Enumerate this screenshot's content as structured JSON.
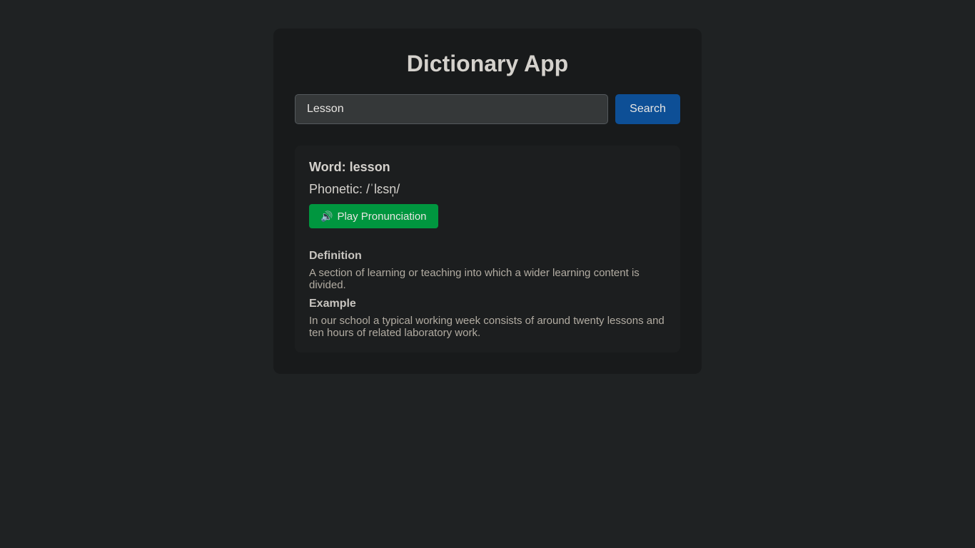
{
  "app": {
    "title": "Dictionary App"
  },
  "search": {
    "value": "Lesson",
    "button_label": "Search"
  },
  "result": {
    "word_label": "Word: lesson",
    "phonetic_label": "Phonetic: /ˈlɛsn̩/",
    "play_label": "Play Pronunciation",
    "play_icon": "speaker-icon",
    "definition_heading": "Definition",
    "definition_text": "A section of learning or teaching into which a wider learning content is divided.",
    "example_heading": "Example",
    "example_text": "In our school a typical working week consists of around twenty lessons and ten hours of related laboratory work."
  },
  "colors": {
    "page_bg": "#1f2223",
    "card_bg": "#181a1b",
    "search_button": "#0d4f96",
    "play_button": "#00963f"
  }
}
